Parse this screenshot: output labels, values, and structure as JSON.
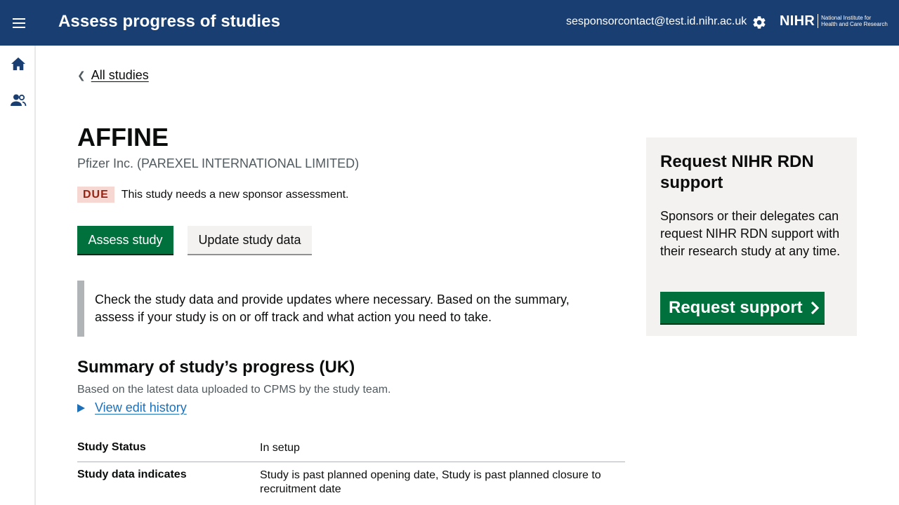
{
  "header": {
    "title": "Assess progress of studies",
    "user_email": "sesponsorcontact@test.id.nihr.ac.uk",
    "logo_main": "NIHR",
    "logo_sub_line1": "National Institute for",
    "logo_sub_line2": "Health and Care Research",
    "bg_color": "#193e72"
  },
  "nav": {
    "items": [
      {
        "icon": "home-icon"
      },
      {
        "icon": "people-icon"
      }
    ]
  },
  "breadcrumb": {
    "back_label": "All studies"
  },
  "study": {
    "title": "AFFINE",
    "sponsor": "Pfizer Inc. (PAREXEL INTERNATIONAL LIMITED)",
    "status_tag": "DUE",
    "status_text": "This study needs a new sponsor assessment."
  },
  "actions": {
    "assess_label": "Assess study",
    "update_label": "Update study data"
  },
  "inset": {
    "line1": "Check the study data and provide updates where necessary. Based on the summary,",
    "line2": "assess if your study is on or off track and what action you need to take."
  },
  "summary": {
    "heading": "Summary of study’s progress (UK)",
    "subtext": "Based on the latest data uploaded to CPMS by the study team.",
    "history_link": "View edit history",
    "rows": [
      {
        "key": "Study Status",
        "value": "In setup"
      },
      {
        "key": "Study data indicates",
        "value": "Study is past planned opening date, Study is past planned closure to recruitment date"
      }
    ]
  },
  "support_panel": {
    "heading": "Request NIHR RDN support",
    "body": "Sponsors or their delegates can request NIHR RDN support with their research study at any time.",
    "button_label": "Request support"
  },
  "colors": {
    "primary_green": "#00703c",
    "link_blue": "#1d70b8",
    "due_bg": "#f6d7d2",
    "due_text": "#942514"
  }
}
